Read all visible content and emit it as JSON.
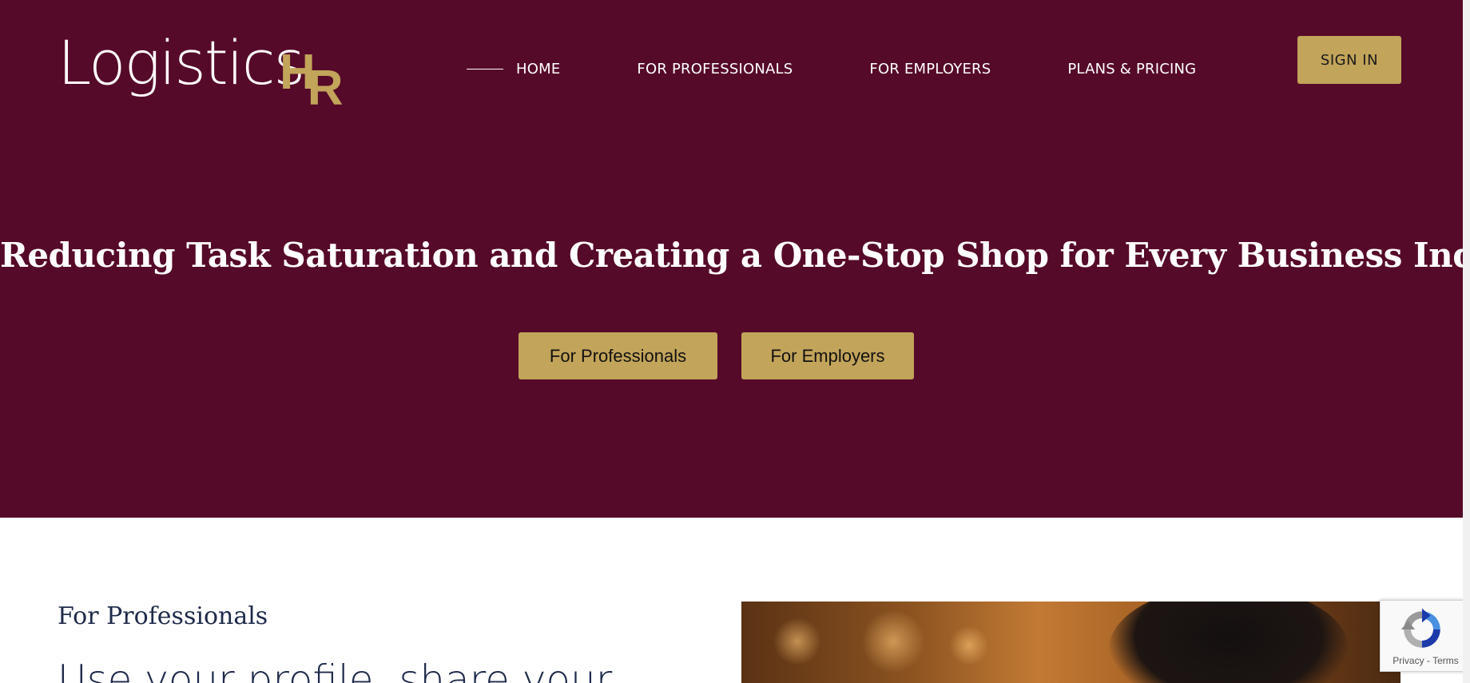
{
  "header": {
    "logo": {
      "text": "Logistics",
      "suffix_1": "H",
      "suffix_2": "R"
    },
    "nav": [
      {
        "label": "HOME"
      },
      {
        "label": "FOR PROFESSIONALS"
      },
      {
        "label": "FOR EMPLOYERS"
      },
      {
        "label": "PLANS & PRICING"
      }
    ],
    "signin_label": "SIGN IN"
  },
  "hero": {
    "title": "Reducing Task Saturation and Creating a One-Stop Shop for Every Business Industry",
    "buttons": {
      "professionals": "For Professionals",
      "employers": "For Employers"
    }
  },
  "section": {
    "eyebrow": "For Professionals",
    "heading": "Use your profile, share your"
  },
  "recaptcha": {
    "privacy": "Privacy",
    "separator": " - ",
    "terms": "Terms"
  },
  "colors": {
    "brand_maroon": "#560a29",
    "accent_gold": "#c2a45a",
    "heading_navy": "#1e2a4a"
  },
  "icons": {
    "recaptcha": "recaptcha-icon"
  }
}
